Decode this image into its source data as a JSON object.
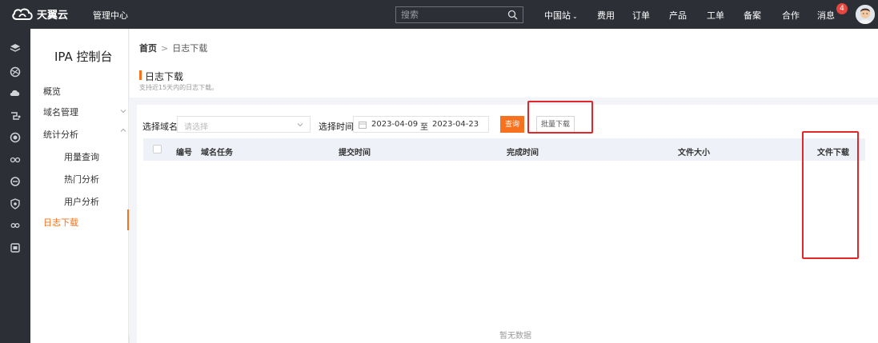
{
  "topbar": {
    "brand": "天翼云",
    "management": "管理中心",
    "search_placeholder": "搜索",
    "nav": {
      "region": "中国站",
      "fees": "费用",
      "orders": "订单",
      "products": "产品",
      "tickets": "工单",
      "icp": "备案",
      "partner": "合作",
      "messages": "消息"
    },
    "message_count": "4"
  },
  "rail_icons": [
    "layers-icon",
    "globe-icon",
    "cloud-icon",
    "network-icon",
    "target-icon",
    "nodes-icon",
    "ring-icon",
    "shield-icon",
    "link-icon",
    "box-icon"
  ],
  "sidebar": {
    "title": "IPA 控制台",
    "items": {
      "overview": "概览",
      "domain_mgmt": "域名管理",
      "stats": "统计分析",
      "usage": "用量查询",
      "hot": "热门分析",
      "users": "用户分析",
      "log_download": "日志下载"
    }
  },
  "breadcrumb": {
    "home": "首页",
    "separator": ">",
    "current": "日志下载"
  },
  "page": {
    "title": "日志下载",
    "subtitle": "支持近15天内的日志下载。"
  },
  "filters": {
    "domain_label": "选择域名",
    "domain_placeholder": "请选择",
    "time_label": "选择时间",
    "start_date": "2023-04-09",
    "to": "至",
    "end_date": "2023-04-23",
    "query_button": "查询",
    "batch_button": "批量下载"
  },
  "table": {
    "columns": {
      "id": "编号",
      "task": "域名任务",
      "submit_time": "提交时间",
      "finish_time": "完成时间",
      "size": "文件大小",
      "download": "文件下载"
    },
    "empty_text": "暂无数据"
  },
  "colors": {
    "accent": "#f7711e",
    "topbar": "#2c2f36",
    "annotation": "#e3262a",
    "badge": "#e5463e"
  }
}
